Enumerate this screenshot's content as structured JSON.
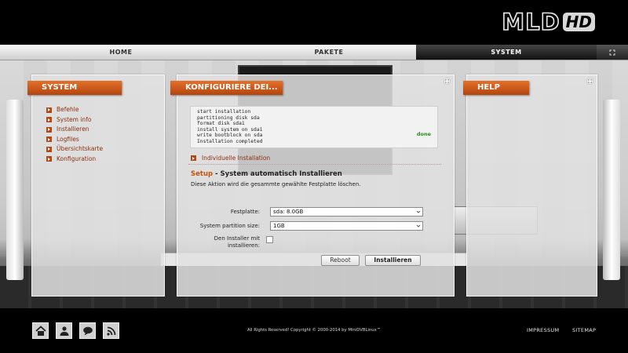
{
  "logo": {
    "main": "MLD",
    "badge": "HD"
  },
  "nav": {
    "tabs": [
      {
        "label": "HOME"
      },
      {
        "label": "PAKETE"
      },
      {
        "label": "SYSTEM"
      }
    ],
    "active": "SYSTEM"
  },
  "panels": {
    "system": {
      "title": "SYSTEM",
      "items": [
        {
          "label": "Befehle"
        },
        {
          "label": "System info"
        },
        {
          "label": "Installieren"
        },
        {
          "label": "Logfiles"
        },
        {
          "label": "Übersichtskarte"
        },
        {
          "label": "Konfiguration"
        }
      ]
    },
    "config": {
      "title": "KONFIGURIERE DEI...",
      "console": {
        "lines": [
          "start installation",
          "partitioning disk sda",
          "format disk sda1",
          "install system on sda1",
          "write bootblock on sda",
          "Installation completed"
        ],
        "status": "done"
      },
      "individual_link": "Individuelle Installation",
      "setup_prefix": "Setup",
      "setup_title": " - System automatisch Installieren",
      "description": "Diese Aktion wird die gesammte gewählte Festplatte löschen.",
      "form": {
        "disk_label": "Festplatte:",
        "disk_value": "sda: 8.0GB",
        "partition_label": "System partition size:",
        "partition_value": "1GB",
        "installer_label": "Den Installer mit installieren:",
        "installer_checked": false
      },
      "buttons": {
        "reboot": "Reboot",
        "install": "Installieren"
      }
    },
    "help": {
      "title": "HELP"
    }
  },
  "footer": {
    "icons": [
      "home-icon",
      "user-account-icon",
      "chat-icon",
      "rss-icon"
    ],
    "copyright": "All Rights Reserved! Copyright © 2000-2014 by MiniDVBLinux™",
    "links": [
      {
        "label": "IMPRESSUM"
      },
      {
        "label": "SITEMAP"
      }
    ]
  },
  "colors": {
    "accent": "#c4510f",
    "link": "#8a3010",
    "done": "#2c8a1e"
  }
}
